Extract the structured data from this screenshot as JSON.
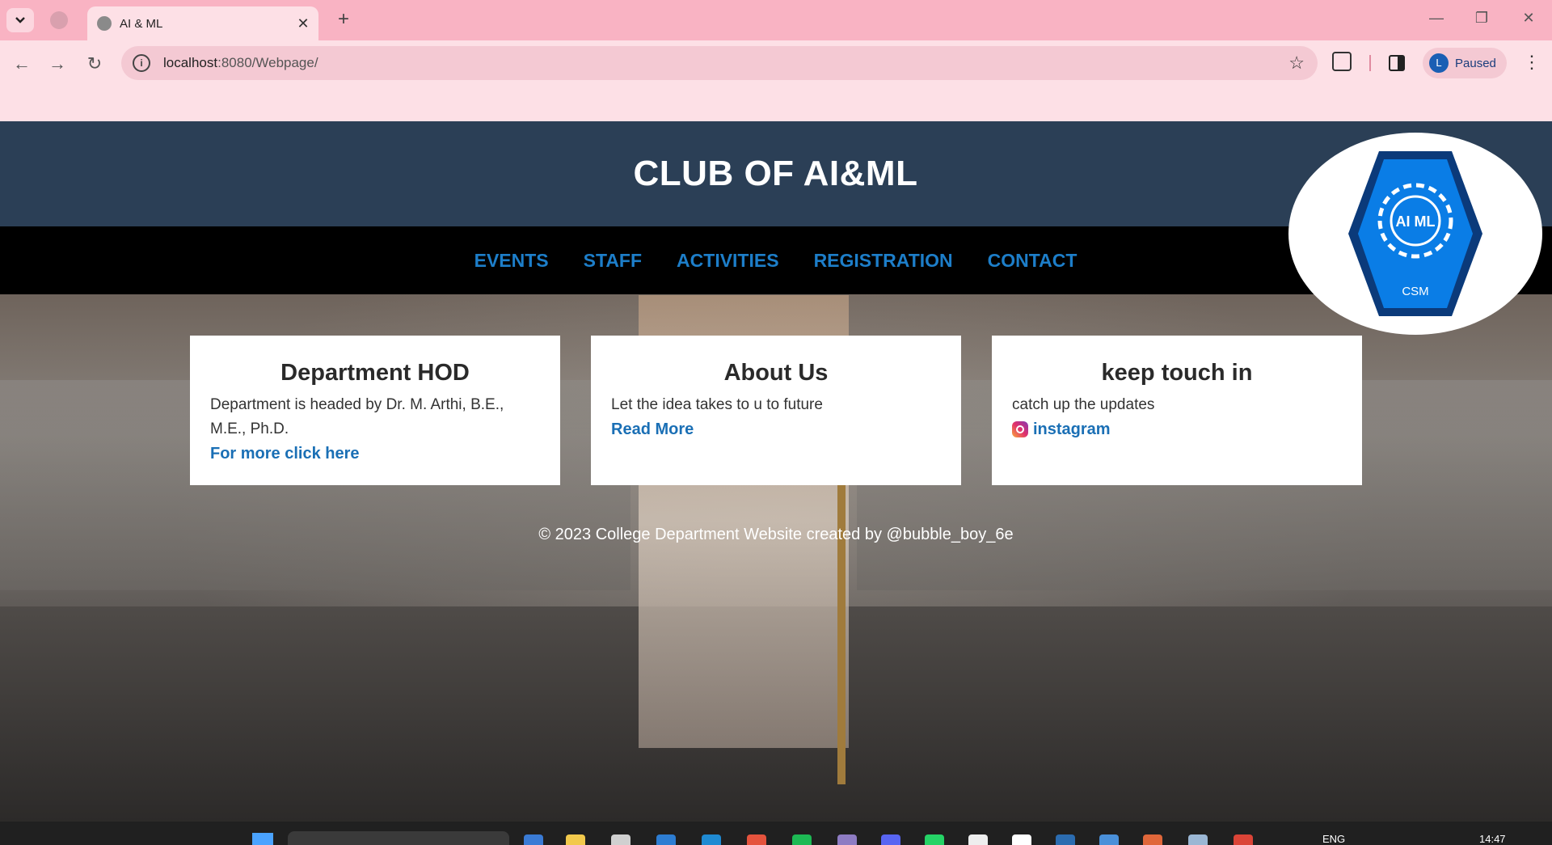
{
  "browser": {
    "tab_title": "AI & ML",
    "url_host": "localhost",
    "url_rest": ":8080/Webpage/",
    "profile_initial": "L",
    "profile_status": "Paused"
  },
  "header": {
    "title": "CLUB OF AI&ML"
  },
  "nav": {
    "items": [
      {
        "label": "EVENTS"
      },
      {
        "label": "STAFF"
      },
      {
        "label": "ACTIVITIES"
      },
      {
        "label": "REGISTRATION"
      },
      {
        "label": "CONTACT"
      }
    ]
  },
  "logo": {
    "center_text": "AI ML",
    "bottom_text": "CSM"
  },
  "cards": [
    {
      "title": "Department HOD",
      "text": "Department is headed by Dr. M. Arthi, B.E., M.E., Ph.D.",
      "link": "For more click here"
    },
    {
      "title": "About Us",
      "text": "Let the idea takes to u to future",
      "link": "Read More"
    },
    {
      "title": "keep touch in",
      "text": "catch up the updates",
      "link": "instagram"
    }
  ],
  "footer": {
    "text": "© 2023 College Department Website created by @bubble_boy_6e"
  },
  "taskbar": {
    "lang": "ENG",
    "time": "14:47"
  },
  "colors": {
    "header_bg": "#2b3f56",
    "nav_bg": "#000000",
    "nav_link": "#1d7ec9",
    "link": "#1a6fb5",
    "browser_frame": "#f9b3c3"
  }
}
